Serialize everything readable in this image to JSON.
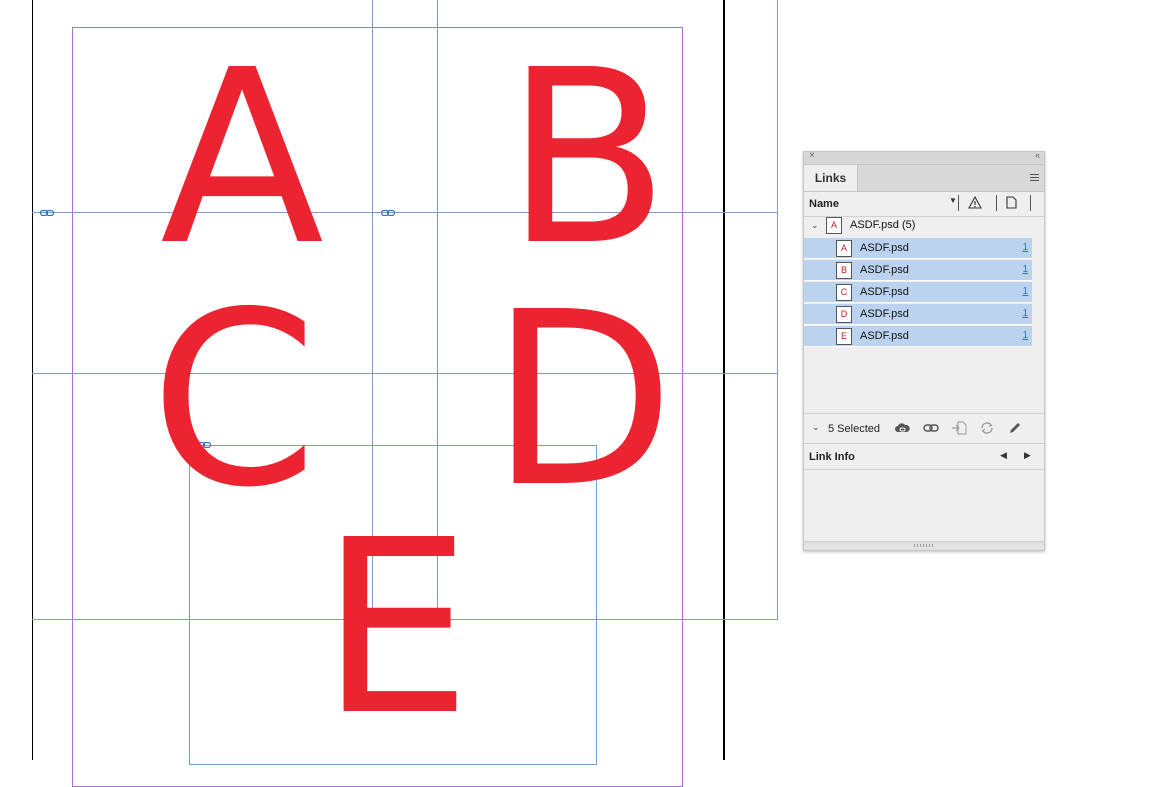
{
  "letters": [
    "A",
    "B",
    "C",
    "D",
    "E"
  ],
  "panel": {
    "close_glyph": "×",
    "collapse_glyph": "‹‹",
    "tab_label": "Links",
    "menu_icon": "panel-menu-icon",
    "column_name": "Name",
    "group": {
      "label": "ASDF.psd (5)",
      "thumb_letter": "A"
    },
    "rows": [
      {
        "thumb_letter": "A",
        "label": "ASDF.psd",
        "page": "1"
      },
      {
        "thumb_letter": "B",
        "label": "ASDF.psd",
        "page": "1"
      },
      {
        "thumb_letter": "C",
        "label": "ASDF.psd",
        "page": "1"
      },
      {
        "thumb_letter": "D",
        "label": "ASDF.psd",
        "page": "1"
      },
      {
        "thumb_letter": "E",
        "label": "ASDF.psd",
        "page": "1"
      }
    ],
    "selected_count": "5 Selected",
    "link_info_label": "Link Info"
  },
  "colors": {
    "letter_red": "#ec2330",
    "selection_blue": "#bcd3ef",
    "guide_blue": "#7f9cc0",
    "margin_purple": "#b46bd8"
  }
}
